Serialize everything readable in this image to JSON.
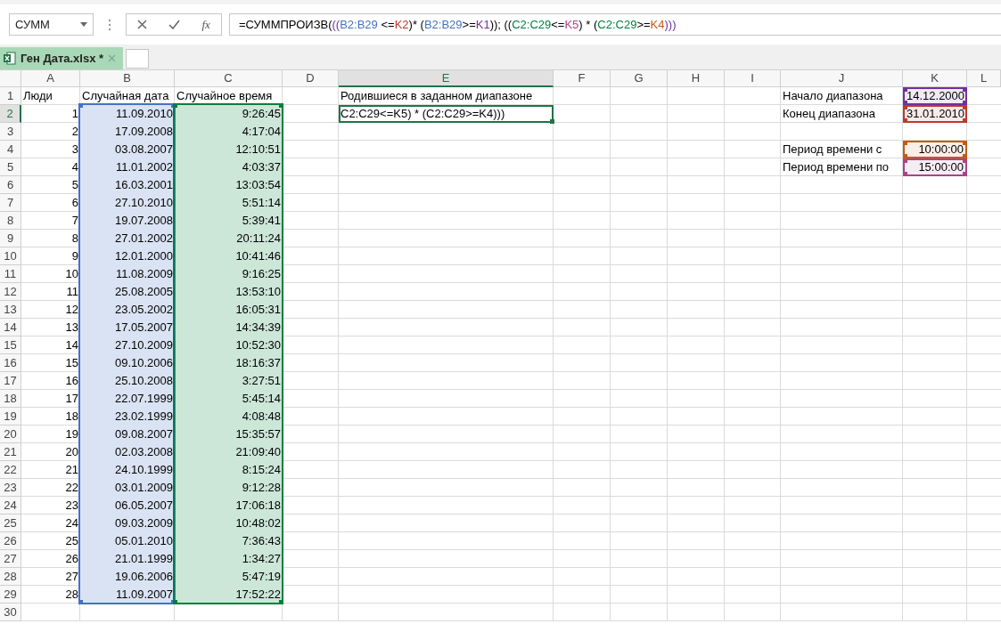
{
  "name_box": {
    "value": "СУММ"
  },
  "fx_label": "fx",
  "formula": [
    {
      "text": "=СУММПРОИЗВ(",
      "color": "#000000"
    },
    {
      "text": "((",
      "color": "#7030a0"
    },
    {
      "text": "B2:B29",
      "color": "#4472c4"
    },
    {
      "text": " <=",
      "color": "#000000"
    },
    {
      "text": "K2",
      "color": "#c0392b"
    },
    {
      "text": ")* (",
      "color": "#000000"
    },
    {
      "text": "B2:B29",
      "color": "#4472c4"
    },
    {
      "text": ">=",
      "color": "#000000"
    },
    {
      "text": "K1",
      "color": "#7030a0"
    },
    {
      "text": ")); ((",
      "color": "#000000"
    },
    {
      "text": "C2:C29",
      "color": "#00803c"
    },
    {
      "text": "<=",
      "color": "#000000"
    },
    {
      "text": "K5",
      "color": "#a9448a"
    },
    {
      "text": ") * (",
      "color": "#000000"
    },
    {
      "text": "C2:C29",
      "color": "#00803c"
    },
    {
      "text": ">=",
      "color": "#000000"
    },
    {
      "text": "K4",
      "color": "#c55a11"
    },
    {
      "text": ")))",
      "color": "#7030a0"
    }
  ],
  "tab": {
    "label": "Ген Дата.xlsx *",
    "selected": true
  },
  "columns": [
    {
      "label": "A",
      "selected": false
    },
    {
      "label": "B",
      "selected": false,
      "color": "#4472c4"
    },
    {
      "label": "C",
      "selected": false,
      "color": "#00803c"
    },
    {
      "label": "D",
      "selected": false
    },
    {
      "label": "E",
      "selected": true
    },
    {
      "label": "F",
      "selected": false
    },
    {
      "label": "G",
      "selected": false
    },
    {
      "label": "H",
      "selected": false
    },
    {
      "label": "I",
      "selected": false
    },
    {
      "label": "J",
      "selected": false
    },
    {
      "label": "K",
      "selected": false
    },
    {
      "label": "L",
      "selected": false
    }
  ],
  "rows": [
    {
      "label": "1",
      "selected": false,
      "in_range": false,
      "cells": [
        "Люди",
        "Случайная дата",
        "Случайное время",
        null,
        "Родившиеся в заданном диапазоне",
        null,
        null,
        null,
        null,
        "Начало диапазона",
        {
          "text": "14.12.2000",
          "color": "#7030a0"
        }
      ]
    },
    {
      "label": "2",
      "selected": true,
      "in_range": true,
      "cells": [
        "1",
        "11.09.2010",
        "9:26:45",
        null,
        {
          "text": "C2:C29<=K5) * (C2:C29>=K4)))",
          "active": true
        },
        null,
        null,
        null,
        null,
        "Конец диапазона",
        {
          "text": "31.01.2010",
          "color": "#c0392b"
        }
      ]
    },
    {
      "label": "3",
      "selected": false,
      "in_range": true,
      "cells": [
        "2",
        "17.09.2008",
        "4:17:04"
      ]
    },
    {
      "label": "4",
      "selected": false,
      "in_range": true,
      "cells": [
        "3",
        "03.08.2007",
        "12:10:51",
        null,
        null,
        null,
        null,
        null,
        null,
        "Период времени с",
        {
          "text": "10:00:00",
          "color": "#c55a11"
        }
      ]
    },
    {
      "label": "5",
      "selected": false,
      "in_range": true,
      "cells": [
        "4",
        "11.01.2002",
        "4:03:37",
        null,
        null,
        null,
        null,
        null,
        null,
        "Период времени по",
        {
          "text": "15:00:00",
          "color": "#a9448a"
        }
      ]
    },
    {
      "label": "6",
      "selected": false,
      "in_range": true,
      "cells": [
        "5",
        "16.03.2001",
        "13:03:54"
      ]
    },
    {
      "label": "7",
      "selected": false,
      "in_range": true,
      "cells": [
        "6",
        "27.10.2010",
        "5:51:14"
      ]
    },
    {
      "label": "8",
      "selected": false,
      "in_range": true,
      "cells": [
        "7",
        "19.07.2008",
        "5:39:41"
      ]
    },
    {
      "label": "9",
      "selected": false,
      "in_range": true,
      "cells": [
        "8",
        "27.01.2002",
        "20:11:24"
      ]
    },
    {
      "label": "10",
      "selected": false,
      "in_range": true,
      "cells": [
        "9",
        "12.01.2000",
        "10:41:46"
      ]
    },
    {
      "label": "11",
      "selected": false,
      "in_range": true,
      "cells": [
        "10",
        "11.08.2009",
        "9:16:25"
      ]
    },
    {
      "label": "12",
      "selected": false,
      "in_range": true,
      "cells": [
        "11",
        "25.08.2005",
        "13:53:10"
      ]
    },
    {
      "label": "13",
      "selected": false,
      "in_range": true,
      "cells": [
        "12",
        "23.05.2002",
        "16:05:31"
      ]
    },
    {
      "label": "14",
      "selected": false,
      "in_range": true,
      "cells": [
        "13",
        "17.05.2007",
        "14:34:39"
      ]
    },
    {
      "label": "15",
      "selected": false,
      "in_range": true,
      "cells": [
        "14",
        "27.10.2009",
        "10:52:30"
      ]
    },
    {
      "label": "16",
      "selected": false,
      "in_range": true,
      "cells": [
        "15",
        "09.10.2006",
        "18:16:37"
      ]
    },
    {
      "label": "17",
      "selected": false,
      "in_range": true,
      "cells": [
        "16",
        "25.10.2008",
        "3:27:51"
      ]
    },
    {
      "label": "18",
      "selected": false,
      "in_range": true,
      "cells": [
        "17",
        "22.07.1999",
        "5:45:14"
      ]
    },
    {
      "label": "19",
      "selected": false,
      "in_range": true,
      "cells": [
        "18",
        "23.02.1999",
        "4:08:48"
      ]
    },
    {
      "label": "20",
      "selected": false,
      "in_range": true,
      "cells": [
        "19",
        "09.08.2007",
        "15:35:57"
      ]
    },
    {
      "label": "21",
      "selected": false,
      "in_range": true,
      "cells": [
        "20",
        "02.03.2008",
        "21:09:40"
      ]
    },
    {
      "label": "22",
      "selected": false,
      "in_range": true,
      "cells": [
        "21",
        "24.10.1999",
        "8:15:24"
      ]
    },
    {
      "label": "23",
      "selected": false,
      "in_range": true,
      "cells": [
        "22",
        "03.01.2009",
        "9:12:28"
      ]
    },
    {
      "label": "24",
      "selected": false,
      "in_range": true,
      "cells": [
        "23",
        "06.05.2007",
        "17:06:18"
      ]
    },
    {
      "label": "25",
      "selected": false,
      "in_range": true,
      "cells": [
        "24",
        "09.03.2009",
        "10:48:02"
      ]
    },
    {
      "label": "26",
      "selected": false,
      "in_range": true,
      "cells": [
        "25",
        "05.01.2010",
        "7:36:43"
      ]
    },
    {
      "label": "27",
      "selected": false,
      "in_range": true,
      "cells": [
        "26",
        "21.01.1999",
        "1:34:27"
      ]
    },
    {
      "label": "28",
      "selected": false,
      "in_range": true,
      "cells": [
        "27",
        "19.06.2006",
        "5:47:19"
      ]
    },
    {
      "label": "29",
      "selected": false,
      "in_range": true,
      "cells": [
        "28",
        "11.09.2007",
        "17:52:22"
      ]
    },
    {
      "label": "30",
      "selected": false,
      "in_range": false,
      "cells": []
    }
  ]
}
